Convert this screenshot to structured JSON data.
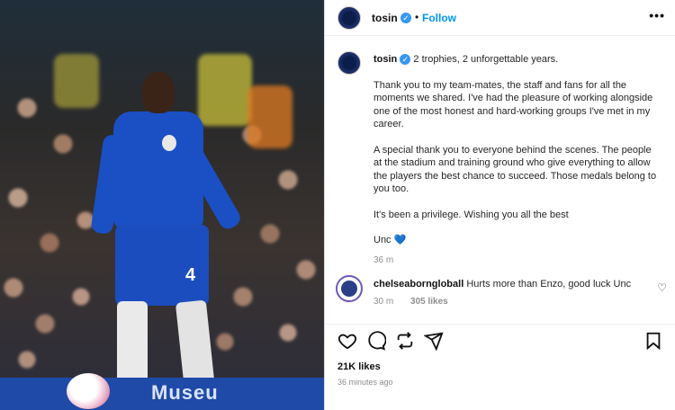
{
  "post": {
    "username": "tosin",
    "follow_label": "Follow",
    "more_label": "•••",
    "separator": "•",
    "caption_first": "2 trophies, 2 unforgettable years.",
    "caption_p1": "Thank you to my team-mates, the staff and fans for all the moments we shared. I've had the pleasure of working alongside one of the most honest and hard-working groups I've met in my career.",
    "caption_p2": "A special thank you to everyone behind the scenes. The people at the stadium and training ground who give everything to allow the players the best chance to succeed. Those medals belong to you too.",
    "caption_p3": "It's been a privilege. Wishing you all the best",
    "caption_p4": "Unc",
    "caption_p4_emoji": "💙",
    "caption_time": "36 m"
  },
  "comment": {
    "username": "chelseaborngloball",
    "text": "Hurts more than Enzo, good luck Unc",
    "time": "30 m",
    "likes": "305 likes"
  },
  "footer": {
    "likes": "21K likes",
    "time_ago": "36 minutes ago"
  },
  "photo": {
    "jersey_number": "4",
    "board_text": "Museu"
  },
  "colors": {
    "follow": "#0095f6",
    "verified": "#3897f0",
    "jersey": "#1b4fc4"
  }
}
